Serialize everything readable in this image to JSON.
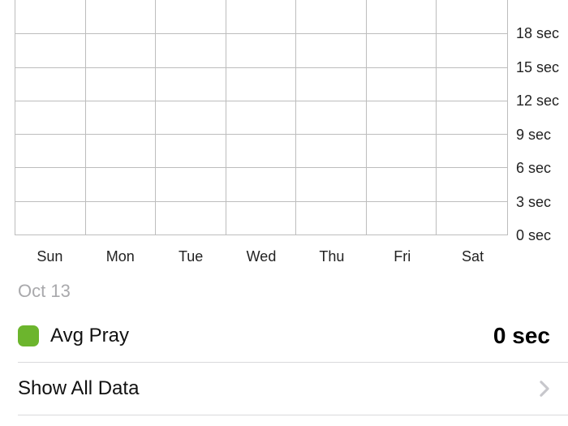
{
  "chart_data": {
    "type": "bar",
    "categories": [
      "Sun",
      "Mon",
      "Tue",
      "Wed",
      "Thu",
      "Fri",
      "Sat"
    ],
    "values": [
      0,
      0,
      0,
      0,
      0,
      0,
      0
    ],
    "title": "",
    "xlabel": "",
    "ylabel": "",
    "ylim": [
      0,
      18
    ],
    "y_ticks": [
      "18 sec",
      "15 sec",
      "12 sec",
      "9 sec",
      "6 sec",
      "3 sec",
      "0 sec"
    ],
    "y_unit": "sec"
  },
  "date_label": "Oct 13",
  "metric": {
    "swatch_color": "#6cb52d",
    "label": "Avg Pray",
    "value": "0 sec"
  },
  "show_all": {
    "label": "Show All Data"
  }
}
